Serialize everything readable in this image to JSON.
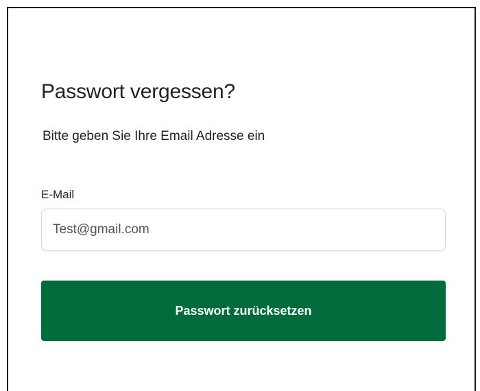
{
  "form": {
    "title": "Passwort vergessen?",
    "subtitle": "Bitte geben Sie Ihre Email Adresse ein",
    "email_label": "E-Mail",
    "email_value": "Test@gmail.com",
    "submit_label": "Passwort zurücksetzen"
  },
  "colors": {
    "accent": "#006c3b",
    "text": "#222222",
    "border": "#d9d9d9"
  }
}
